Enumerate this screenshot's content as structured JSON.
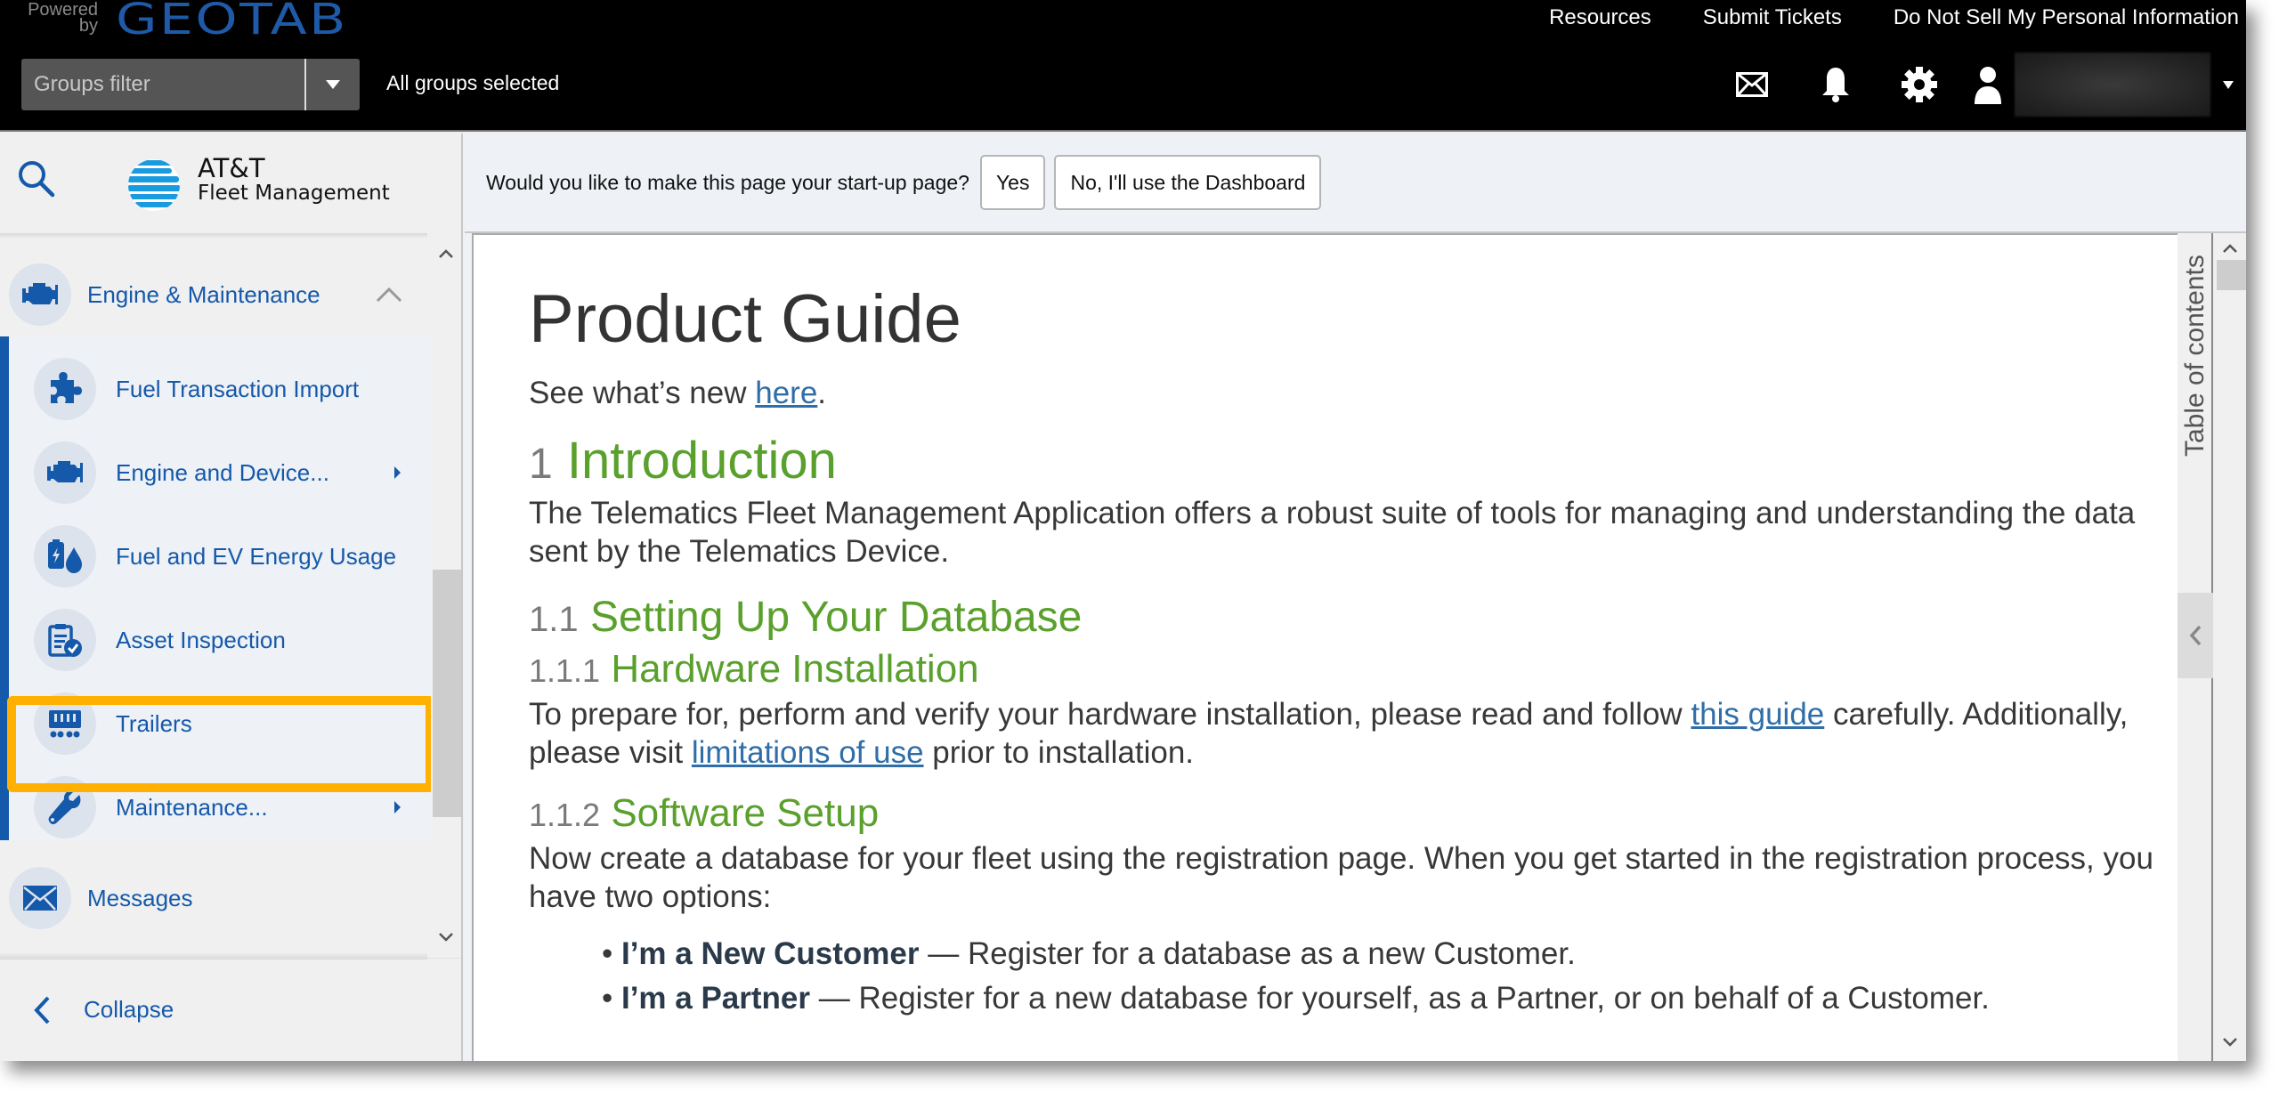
{
  "header": {
    "powered_by": "Powered by",
    "brand": "GEOTAB",
    "links": [
      "Resources",
      "Submit Tickets",
      "Do Not Sell My Personal Information"
    ],
    "groups_filter": {
      "placeholder": "Groups filter",
      "status": "All groups selected"
    },
    "icons": [
      "mail-icon",
      "bell-icon",
      "gear-icon",
      "user-icon"
    ]
  },
  "sidebar": {
    "logo": {
      "line1": "AT&T",
      "line2": "Fleet Management"
    },
    "group": {
      "label": "Engine & Maintenance",
      "expanded": true
    },
    "items": [
      {
        "label": "Fuel Transaction Import",
        "icon": "puzzle-icon",
        "has_submenu": false
      },
      {
        "label": "Engine and Device...",
        "icon": "engine-icon",
        "has_submenu": true
      },
      {
        "label": "Fuel and EV Energy Usage",
        "icon": "fuel-ev-icon",
        "has_submenu": false
      },
      {
        "label": "Asset Inspection",
        "icon": "clipboard-check-icon",
        "has_submenu": false,
        "highlighted": true
      },
      {
        "label": "Trailers",
        "icon": "trailer-icon",
        "has_submenu": false
      },
      {
        "label": "Maintenance...",
        "icon": "wrench-icon",
        "has_submenu": true
      }
    ],
    "messages": "Messages",
    "collapse": "Collapse"
  },
  "main": {
    "startup_prompt": "Would you like to make this page your start-up page?",
    "yes_button": "Yes",
    "no_button": "No, I'll use the Dashboard",
    "toc_label": "Table of contents",
    "doc": {
      "title": "Product Guide",
      "whats_new_prefix": "See what’s new ",
      "whats_new_link": "here",
      "whats_new_suffix": ".",
      "s1": {
        "num": "1",
        "title": "Introduction"
      },
      "s1_text": "The Telematics Fleet Management Application offers a robust suite of tools for managing and understanding the data sent by the Telematics Device.",
      "s11": {
        "num": "1.1",
        "title": "Setting Up Your Database"
      },
      "s111": {
        "num": "1.1.1",
        "title": "Hardware Installation"
      },
      "s111_text_1": "To prepare for, perform and verify your hardware installation, please read and follow ",
      "s111_link_1": "this guide",
      "s111_text_2": " carefully. Additionally, please visit ",
      "s111_link_2": "limitations of use",
      "s111_text_3": " prior to installation.",
      "s112": {
        "num": "1.1.2",
        "title": "Software Setup"
      },
      "s112_text": "Now create a database for your fleet using the registration page. When you get started in the registration process, you have two options:",
      "options": [
        {
          "bold": "I’m a New Customer",
          "text": " — Register for a database as a new Customer."
        },
        {
          "bold": "I’m a Partner",
          "text": " — Register for a new database for yourself, as a Partner, or on behalf of a Customer."
        }
      ]
    }
  },
  "colors": {
    "accent_blue": "#1559aa",
    "heading_green": "#5aa02c",
    "highlight_orange": "#ffb000",
    "link_blue": "#2f6ea8"
  }
}
